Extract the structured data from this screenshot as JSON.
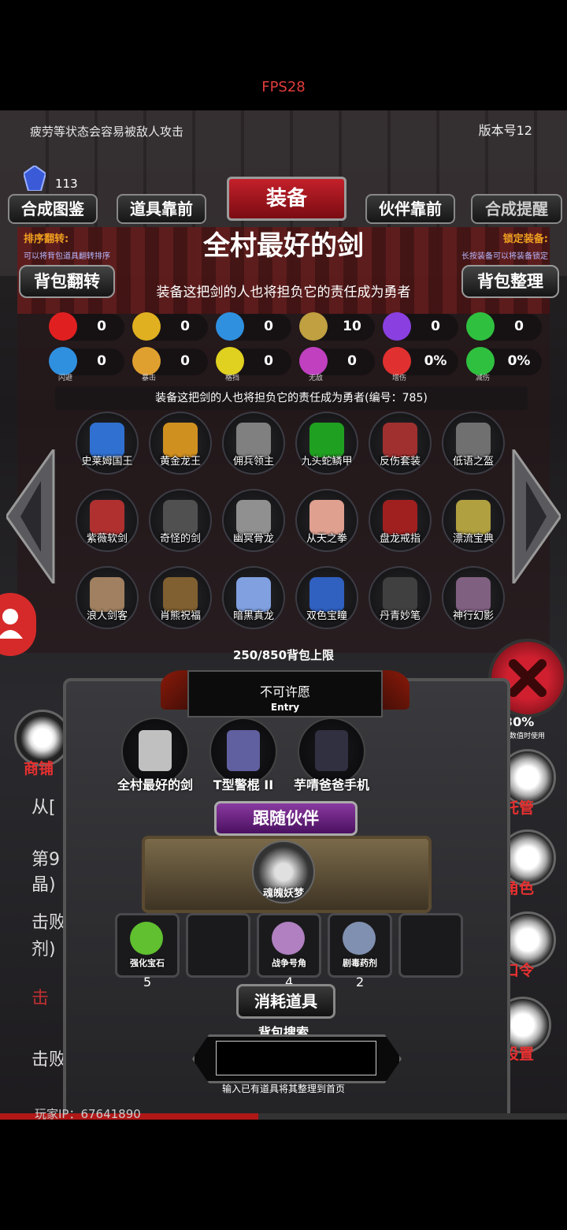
{
  "fps": "FPS28",
  "tip": "疲劳等状态会容易被敌人攻击",
  "version": "版本号12",
  "gems": "113",
  "tabs": {
    "t1": "合成图鉴",
    "t2": "道具靠前",
    "title": "装备",
    "t3": "伙伴靠前",
    "t4": "合成提醒"
  },
  "sort": {
    "label": "排序翻转:",
    "sub": "可以将背包道具翻转排序"
  },
  "lock": {
    "label": "锁定装备:",
    "sub": "长按装备可以将装备锁定"
  },
  "item": {
    "name": "全村最好的剑",
    "desc": "装备这把剑的人也将担负它的责任成为勇者",
    "desc_full": "装备这把剑的人也将担负它的责任成为勇者(编号：785)"
  },
  "buttons": {
    "flip": "背包翻转",
    "arrange": "背包整理"
  },
  "stats_row1": [
    {
      "icon": "heart-icon",
      "color": "#e02020",
      "value": "0"
    },
    {
      "icon": "strength-icon",
      "color": "#e0b020",
      "value": "0"
    },
    {
      "icon": "shoe-icon",
      "color": "#3090e0",
      "value": "0"
    },
    {
      "icon": "bow-icon",
      "color": "#c0a040",
      "value": "10"
    },
    {
      "icon": "lightning-icon",
      "color": "#8a40e0",
      "value": "0"
    },
    {
      "icon": "clover-icon",
      "color": "#30c040",
      "value": "0"
    }
  ],
  "stats_row2": [
    {
      "icon": "dodge-icon",
      "color": "#3090e0",
      "value": "0",
      "label": "闪避"
    },
    {
      "icon": "crit-icon",
      "color": "#e0a030",
      "value": "0",
      "label": "暴击"
    },
    {
      "icon": "block-icon",
      "color": "#e0d020",
      "value": "0",
      "label": "格挡"
    },
    {
      "icon": "invincible-icon",
      "color": "#c040c0",
      "value": "0",
      "label": "无敌"
    },
    {
      "icon": "damage-up-icon",
      "color": "#e03030",
      "value": "0%",
      "label": "增伤"
    },
    {
      "icon": "damage-down-icon",
      "color": "#30c040",
      "value": "0%",
      "label": "减伤"
    }
  ],
  "inventory": [
    {
      "name": "史莱姆国王",
      "color": "#3070d0"
    },
    {
      "name": "黄金龙王",
      "color": "#d09020"
    },
    {
      "name": "佣兵领主",
      "color": "#808080"
    },
    {
      "name": "九头蛇鳞甲",
      "color": "#20a020"
    },
    {
      "name": "反伤套装",
      "color": "#a03030"
    },
    {
      "name": "低语之盔",
      "color": "#707070"
    },
    {
      "name": "紫薇软剑",
      "color": "#b03030"
    },
    {
      "name": "奇怪的剑",
      "color": "#505050"
    },
    {
      "name": "幽冥骨龙",
      "color": "#909090"
    },
    {
      "name": "从天之拳",
      "color": "#e0a090"
    },
    {
      "name": "盘龙戒指",
      "color": "#a02020"
    },
    {
      "name": "漂流宝典",
      "color": "#b0a040"
    },
    {
      "name": "浪人剑客",
      "color": "#a08060"
    },
    {
      "name": "肖熊祝福",
      "color": "#806030"
    },
    {
      "name": "暗黑真龙",
      "color": "#80a0e0"
    },
    {
      "name": "双色宝瞳",
      "color": "#3060c0"
    },
    {
      "name": "丹青妙笔",
      "color": "#404040"
    },
    {
      "name": "神行幻影",
      "color": "#806080"
    }
  ],
  "capacity": "250/850背包上限",
  "wish": {
    "title": "不可许愿",
    "entry": "Entry"
  },
  "equipped": [
    {
      "name": "全村最好的剑",
      "color": "#c0c0c0"
    },
    {
      "name": "T型警棍 II",
      "color": "#6060a0"
    },
    {
      "name": "芋啨爸爸手机",
      "color": "#303040"
    }
  ],
  "companion": {
    "banner": "跟随伙伴",
    "name": "魂魄妖梦"
  },
  "consumables": [
    {
      "name": "强化宝石",
      "count": "5",
      "color": "#60c030"
    },
    {
      "name": "",
      "count": "",
      "color": ""
    },
    {
      "name": "战争号角",
      "count": "4",
      "color": "#b080c0"
    },
    {
      "name": "剧毒药剂",
      "count": "2",
      "color": "#8090b0"
    },
    {
      "name": "",
      "count": "",
      "color": ""
    }
  ],
  "consumable_banner": "消耗道具",
  "search": {
    "label": "背包搜索",
    "value": "",
    "hint": "输入已有道具将其整理到首页"
  },
  "side": {
    "shop": "商铺",
    "manage": "托管",
    "role": "角色",
    "code": "口令",
    "settings": "设置"
  },
  "bg": {
    "t1": "从[",
    "t2": "第9",
    "t3": "晶)",
    "t4": "击败",
    "t5": "剂)",
    "t6": "击",
    "t7": "击败古神分身获得",
    "t8": "30%",
    "t9": "其数值时使用"
  },
  "player_ip": "玩家IP：67641890"
}
